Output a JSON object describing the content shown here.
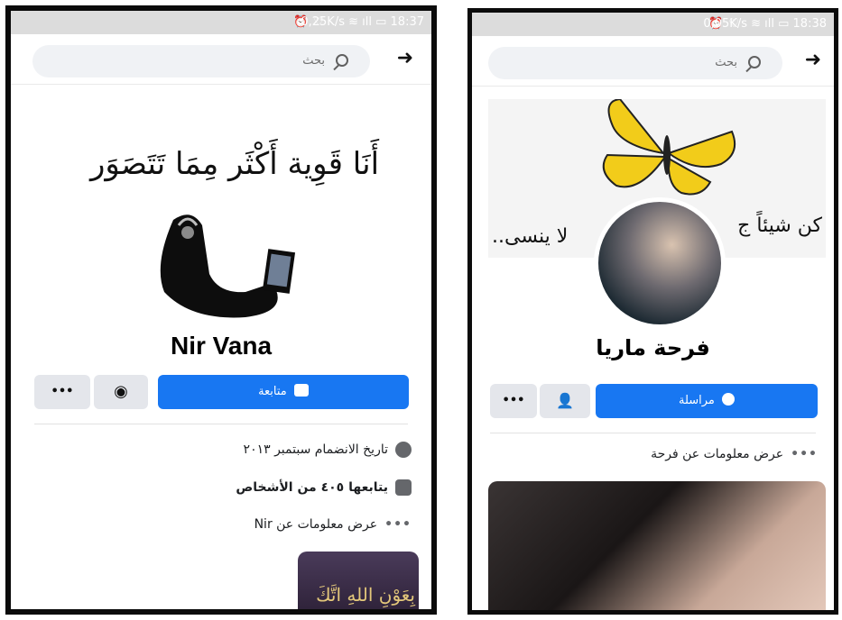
{
  "left": {
    "status_text": "0,25K/s",
    "status_time": "18:37",
    "search_placeholder": "بحث",
    "back_arrow": "➜",
    "cover_quote": "أَنَا قَوِية أَكْثَر مِمَا تَتَصَوَر",
    "profile_name": "Nir Vana",
    "follow_label": "متابعة",
    "more_label": "•••",
    "info": {
      "joined": "تاريخ الانضمام سبتمبر ٢٠١٣",
      "followers": "يتابعها ٤٠٥ من الأشخاص",
      "about": "عرض معلومات عن Nir"
    },
    "photo_text": "بِعَوْنِ اللهِ اتَّكَ"
  },
  "right": {
    "status_text": "0,05K/s",
    "status_time": "18:38",
    "search_placeholder": "بحث",
    "back_arrow": "➜",
    "cover_text_right": "كن شيئاً ج",
    "cover_text_left": "لا ينسى..",
    "profile_name": "فرحة ماريا",
    "message_label": "مراسلة",
    "more_label": "•••",
    "info": {
      "about": "عرض معلومات عن فرحة"
    }
  },
  "colors": {
    "accent": "#1877f2",
    "gray_button": "#e4e6eb",
    "butterfly": "#f2cc1a"
  }
}
